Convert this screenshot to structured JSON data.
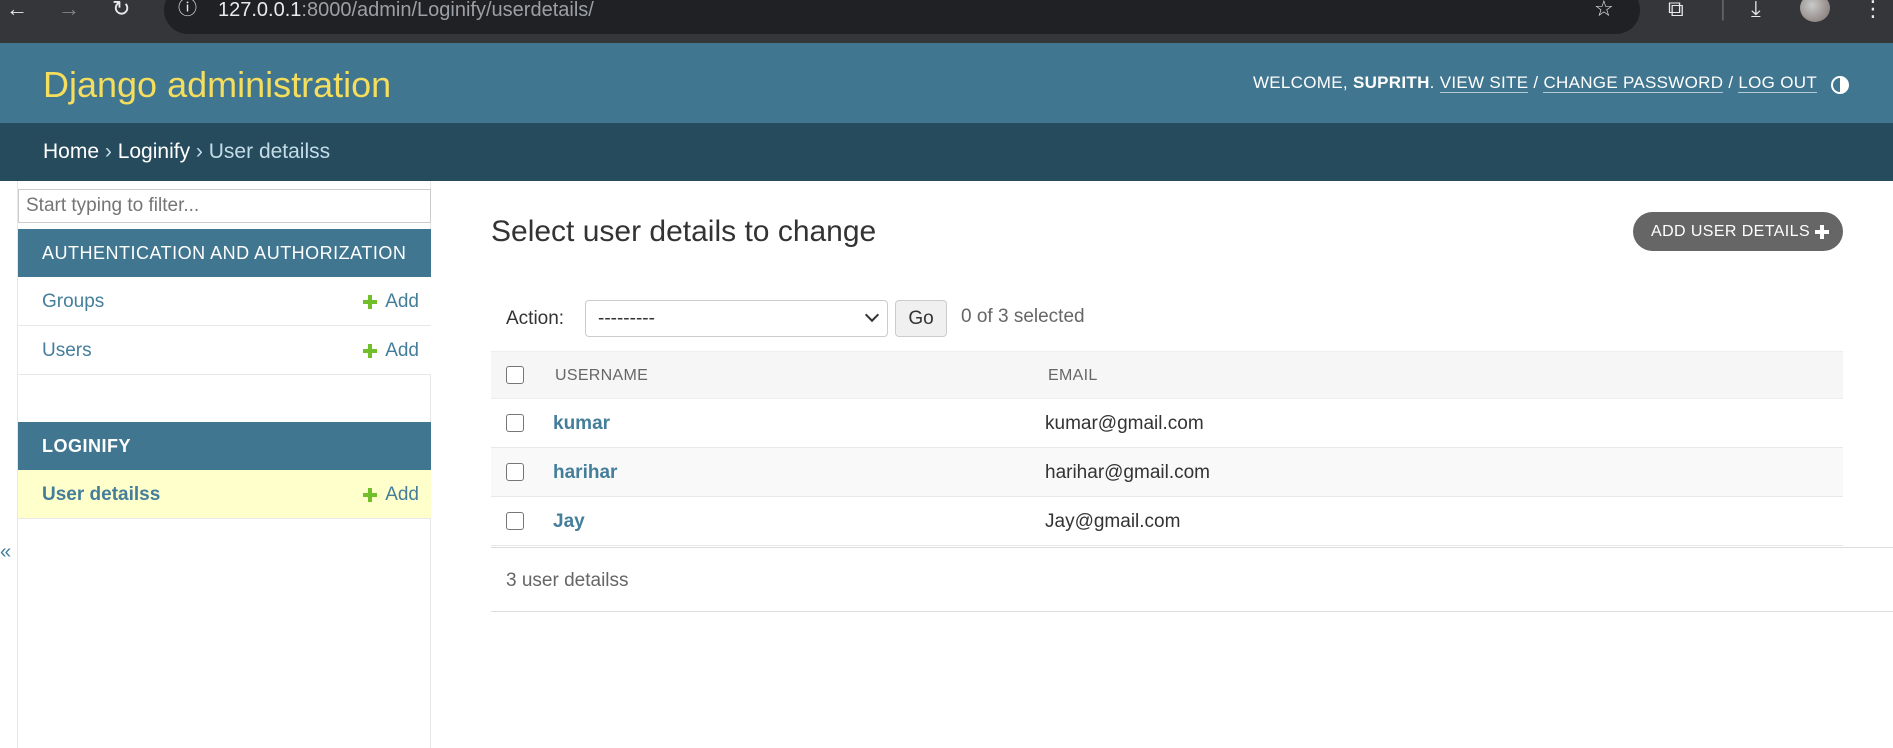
{
  "browser": {
    "url_host": "127.0.0.1",
    "url_rest": ":8000/admin/Loginify/userdetails/"
  },
  "header": {
    "branding": "Django administration",
    "welcome_prefix": "WELCOME, ",
    "username": "SUPRITH",
    "welcome_suffix": ". ",
    "view_site": "VIEW SITE",
    "change_password": "CHANGE PASSWORD",
    "log_out": "LOG OUT",
    "separator": " / "
  },
  "breadcrumbs": {
    "home": "Home",
    "app": "Loginify",
    "current": "User detailss",
    "separator": " › "
  },
  "sidebar": {
    "filter_placeholder": "Start typing to filter...",
    "modules": [
      {
        "caption": "AUTHENTICATION AND AUTHORIZATION",
        "models": [
          {
            "label": "Groups",
            "add": "Add"
          },
          {
            "label": "Users",
            "add": "Add"
          }
        ]
      },
      {
        "caption": "LOGINIFY",
        "models": [
          {
            "label": "User detailss",
            "add": "Add"
          }
        ]
      }
    ],
    "collapse_glyph": "«"
  },
  "content": {
    "title": "Select user details to change",
    "add_button": "ADD USER DETAILS",
    "action_label": "Action:",
    "action_selected": "---------",
    "go_button": "Go",
    "selected_count": "0 of 3 selected",
    "columns": [
      "USERNAME",
      "EMAIL"
    ],
    "rows": [
      {
        "username": "kumar",
        "email": "kumar@gmail.com"
      },
      {
        "username": "harihar",
        "email": "harihar@gmail.com"
      },
      {
        "username": "Jay",
        "email": "Jay@gmail.com"
      }
    ],
    "paginator": "3 user detailss"
  },
  "colors": {
    "header_bg": "#417690",
    "breadcrumbs_bg": "#264b5d",
    "branding": "#f5dd5d",
    "link": "#447e9b",
    "add_green": "#70bf2b",
    "current_row": "#ffffcc"
  }
}
